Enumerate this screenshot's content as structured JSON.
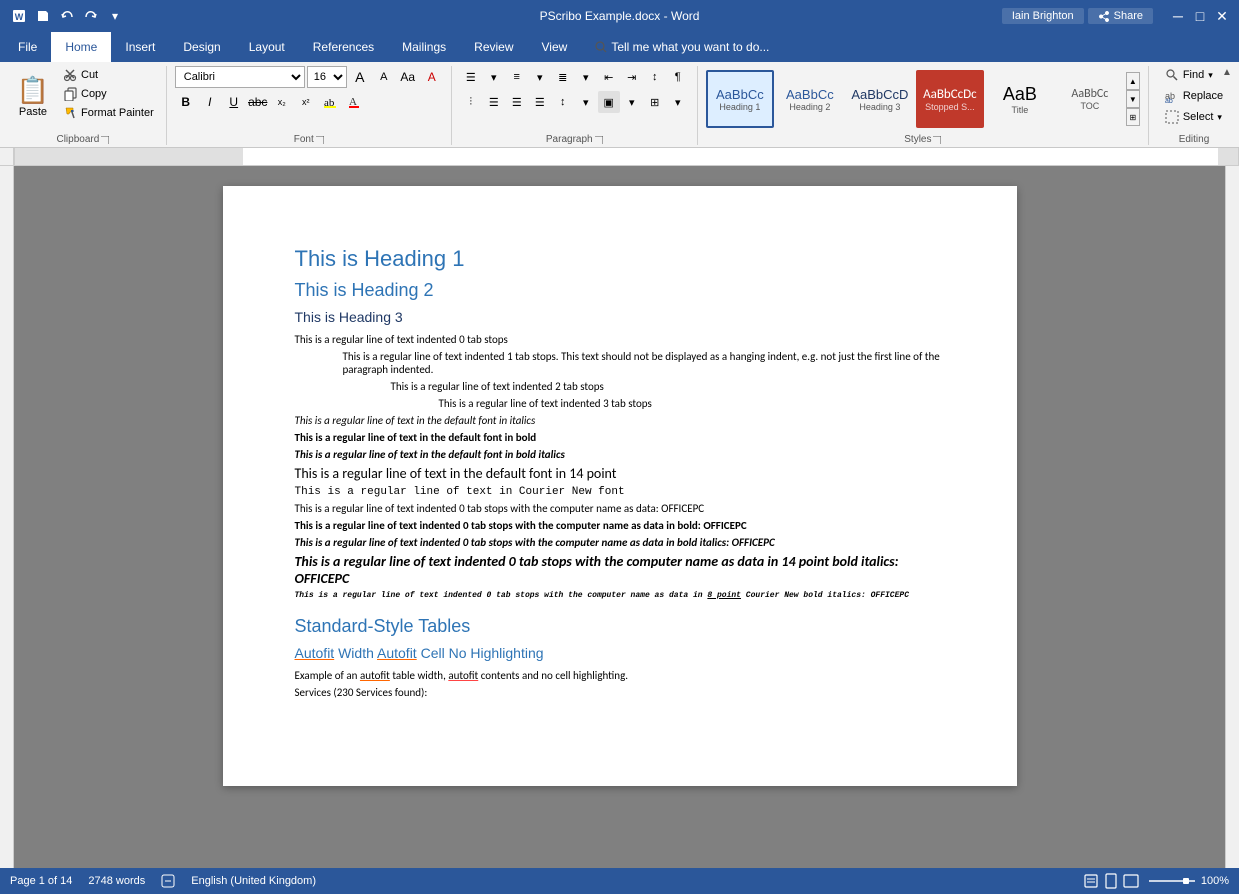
{
  "titleBar": {
    "title": "PScribo Example.docx - Word",
    "quickAccess": [
      "save",
      "undo",
      "redo",
      "customize"
    ],
    "windowControls": [
      "minimize",
      "restore",
      "close"
    ]
  },
  "ribbonTabs": [
    {
      "id": "file",
      "label": "File",
      "active": false
    },
    {
      "id": "home",
      "label": "Home",
      "active": true
    },
    {
      "id": "insert",
      "label": "Insert",
      "active": false
    },
    {
      "id": "design",
      "label": "Design",
      "active": false
    },
    {
      "id": "layout",
      "label": "Layout",
      "active": false
    },
    {
      "id": "references",
      "label": "References",
      "active": false
    },
    {
      "id": "mailings",
      "label": "Mailings",
      "active": false
    },
    {
      "id": "review",
      "label": "Review",
      "active": false
    },
    {
      "id": "view",
      "label": "View",
      "active": false
    },
    {
      "id": "tellme",
      "label": "Tell me what you want to do...",
      "active": false
    }
  ],
  "clipboard": {
    "paste": "Paste",
    "cut": "Cut",
    "copy": "Copy",
    "formatPainter": "Format Painter",
    "groupLabel": "Clipboard"
  },
  "font": {
    "name": "Calibri",
    "size": "16",
    "bold": "B",
    "italic": "I",
    "underline": "U",
    "strikethrough": "abc",
    "subscript": "x₂",
    "superscript": "x²",
    "groupLabel": "Font"
  },
  "paragraph": {
    "groupLabel": "Paragraph"
  },
  "styles": {
    "items": [
      {
        "id": "heading1",
        "label": "Heading 1",
        "preview": "AaBbCc",
        "active": true,
        "color": "#2b579a",
        "bg": "white"
      },
      {
        "id": "heading2",
        "label": "Heading 2",
        "preview": "AaBbCc",
        "active": false,
        "color": "#2b579a",
        "bg": "white"
      },
      {
        "id": "heading3",
        "label": "AaBbCcD",
        "preview": "AaBbCcD",
        "active": false,
        "color": "#1f3864",
        "bg": "white"
      },
      {
        "id": "stopped",
        "label": "Stopped S...",
        "preview": "AaBbCcDc",
        "active": false,
        "color": "white",
        "bg": "#c0392b"
      },
      {
        "id": "title",
        "label": "Title",
        "preview": "AaB",
        "active": false,
        "color": "#000",
        "bg": "white"
      },
      {
        "id": "toc",
        "label": "TOC",
        "preview": "AaBbCc",
        "active": false,
        "color": "#000",
        "bg": "white"
      }
    ],
    "groupLabel": "Styles"
  },
  "editing": {
    "find": "Find",
    "replace": "Replace",
    "select": "Select",
    "groupLabel": "Editing"
  },
  "userInfo": {
    "name": "Iain Brighton",
    "share": "Share"
  },
  "document": {
    "content": [
      {
        "type": "h1",
        "text": "This is Heading 1"
      },
      {
        "type": "h2",
        "text": "This is Heading 2"
      },
      {
        "type": "h3",
        "text": "This is Heading 3"
      },
      {
        "type": "normal",
        "text": "This is a regular line of text indented 0 tab stops",
        "indent": 0
      },
      {
        "type": "normal",
        "text": "This is a regular line of text indented 1 tab stops. This text should not be displayed as a hanging indent, e.g. not just the first line of the paragraph indented.",
        "indent": 1
      },
      {
        "type": "normal",
        "text": "This is a regular line of text indented 2 tab stops",
        "indent": 2
      },
      {
        "type": "normal",
        "text": "This is a regular line of text indented 3 tab stops",
        "indent": 3
      },
      {
        "type": "italic",
        "text": "This is a regular line of text in the default font in italics",
        "indent": 0
      },
      {
        "type": "bold",
        "text": "This is a regular line of text in the default font in bold",
        "indent": 0
      },
      {
        "type": "bold-italic",
        "text": "This is a regular line of text in the default font in bold italics",
        "indent": 0
      },
      {
        "type": "font14",
        "text": "This is a regular line of text in the default font in 14 point",
        "indent": 0
      },
      {
        "type": "courier",
        "text": "This is a regular line of text in Courier New font",
        "indent": 0
      },
      {
        "type": "normal",
        "text": "This is a regular line of text indented 0 tab stops with the computer name as data: OFFICEPC",
        "indent": 0
      },
      {
        "type": "bold",
        "text": "This is a regular line of text indented 0 tab stops with the computer name as data in bold: OFFICEPC",
        "indent": 0
      },
      {
        "type": "bold-italic",
        "text": "This is a regular line of text indented 0 tab stops with the computer name as data in bold italics: OFFICEPC",
        "indent": 0
      },
      {
        "type": "bold-italic-14",
        "text": "This is a regular line of text indented 0 tab stops with the computer name as data in 14 point bold italics: OFFICEPC",
        "indent": 0
      },
      {
        "type": "courier8-bold-italic",
        "text": "This is a regular line of text indented 0 tab stops with the computer name as data in 8 point Courier New bold italics: OFFICEPC",
        "indent": 0
      },
      {
        "type": "h2",
        "text": "Standard-Style Tables"
      },
      {
        "type": "h3-link",
        "text": "Autofit Width Autofit Cell No Highlighting"
      },
      {
        "type": "normal-link",
        "text": "Example of an autofit table width, autofit contents and no cell highlighting."
      },
      {
        "type": "normal",
        "text": "Services (230 Services found):",
        "indent": 0
      }
    ]
  },
  "statusBar": {
    "page": "Page 1 of 14",
    "words": "2748 words",
    "language": "English (United Kingdom)",
    "zoom": "100%"
  }
}
